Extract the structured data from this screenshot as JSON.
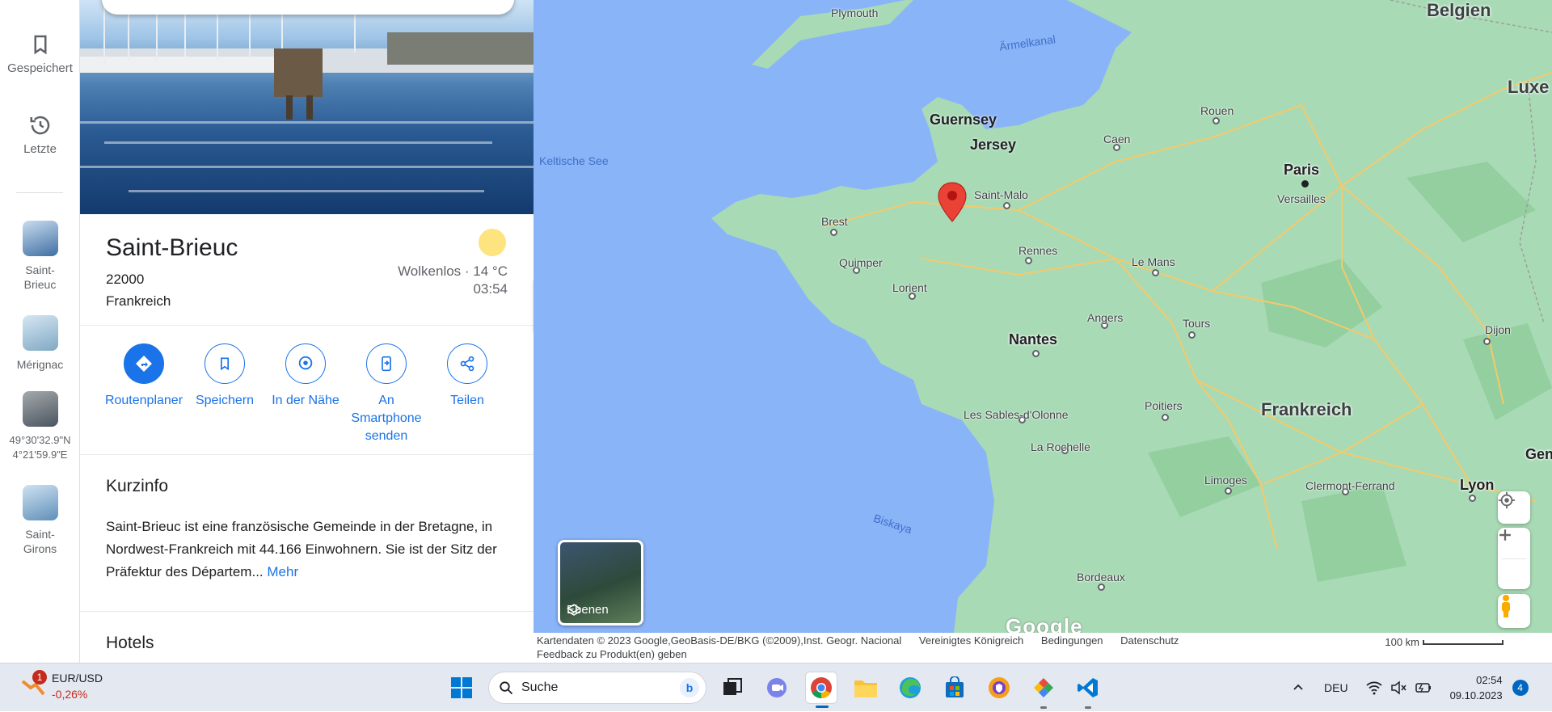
{
  "rail": {
    "saved_label": "Gespeichert",
    "recent_label": "Letzte",
    "recents": [
      {
        "label_1": "Saint-",
        "label_2": "Brieuc",
        "color": "#5b87b8"
      },
      {
        "label_1": "Mérignac",
        "label_2": "",
        "color": "#9dc0da"
      },
      {
        "label_1": "49°30'32.9\"N",
        "label_2": "4°21'59.9\"E",
        "color": "#7c8790"
      },
      {
        "label_1": "Saint-",
        "label_2": "Girons",
        "color": "#7aa7cc"
      }
    ]
  },
  "place": {
    "name": "Saint-Brieuc",
    "postcode": "22000",
    "country": "Frankreich",
    "weather": "Wolkenlos · 14 °C",
    "time": "03:54"
  },
  "actions": {
    "route": "Routenplaner",
    "save": "Speichern",
    "nearby": "In der Nähe",
    "phone_1": "An",
    "phone_2": "Smartphone",
    "phone_3": "senden",
    "share": "Teilen"
  },
  "about": {
    "title": "Kurzinfo",
    "text": "Saint-Brieuc ist eine französische Gemeinde in der Bretagne, in Nordwest-Frankreich mit 44.166 Einwohnern. Sie ist der Sitz der Präfektur des Départem...",
    "more": "Mehr"
  },
  "hotels_title": "Hotels",
  "map": {
    "labels": {
      "belgien": "Belgien",
      "luxe": "Luxe",
      "plymouth": "Plymouth",
      "aermelkanal": "Ärmelkanal",
      "guernsey": "Guernsey",
      "jersey": "Jersey",
      "keltische": "Keltische See",
      "caen": "Caen",
      "rouen": "Rouen",
      "paris": "Paris",
      "versailles": "Versailles",
      "saint_malo": "Saint-Malo",
      "brest": "Brest",
      "quimper": "Quimper",
      "rennes": "Rennes",
      "lorient": "Lorient",
      "le_mans": "Le Mans",
      "angers": "Angers",
      "tours": "Tours",
      "nantes": "Nantes",
      "dijon": "Dijon",
      "sables": "Les Sables-d'Olonne",
      "poitiers": "Poitiers",
      "frankreich": "Frankreich",
      "la_rochelle": "La Rochelle",
      "limoges": "Limoges",
      "clermont": "Clermont-Ferrand",
      "lyon": "Lyon",
      "gen": "Gen",
      "biskaya": "Biskaya",
      "bordeaux": "Bordeaux"
    },
    "layers_label": "Ebenen",
    "google": "Google"
  },
  "attribution": {
    "data": "Kartendaten © 2023 Google,GeoBasis-DE/BKG (©2009),Inst. Geogr. Nacional",
    "region": "Vereinigtes Königreich",
    "terms": "Bedingungen",
    "privacy": "Datenschutz",
    "feedback": "Feedback zu Produkt(en) geben",
    "scale": "100 km"
  },
  "taskbar": {
    "ticker": "EUR/USD",
    "change": "-0,26%",
    "badge": "1",
    "search": "Suche",
    "lang": "DEU",
    "time": "02:54",
    "date": "09.10.2023",
    "notif": "4"
  },
  "colors": {
    "water": "#8ab4f8",
    "land": "#a8dab5",
    "accent": "#1a73e8",
    "pin": "#ea4335"
  }
}
